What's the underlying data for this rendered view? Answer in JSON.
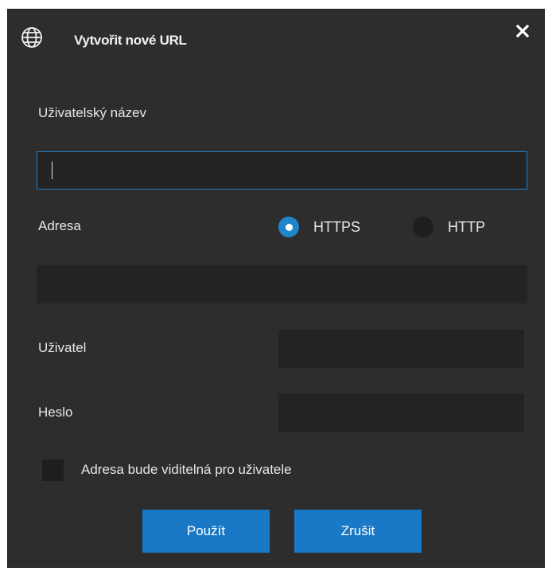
{
  "dialog": {
    "title": "Vytvořit nové URL",
    "icon": "globe-icon",
    "close_icon": "close-icon"
  },
  "form": {
    "display_name_label": "Uživatelský název",
    "display_name_value": "",
    "address_label": "Adresa",
    "protocol_options": [
      {
        "label": "HTTPS",
        "checked": true
      },
      {
        "label": "HTTP",
        "checked": false
      }
    ],
    "address_value": "",
    "user_label": "Uživatel",
    "user_value": "",
    "password_label": "Heslo",
    "password_value": "",
    "visible_checkbox_label": "Adresa bude viditelná pro uživatele",
    "visible_checkbox_checked": false
  },
  "buttons": {
    "apply_label": "Použít",
    "cancel_label": "Zrušit"
  },
  "colors": {
    "dialog_bg": "#2d2d2d",
    "input_bg": "#232323",
    "accent": "#1979c6",
    "focus_border": "#1f7fc4"
  }
}
